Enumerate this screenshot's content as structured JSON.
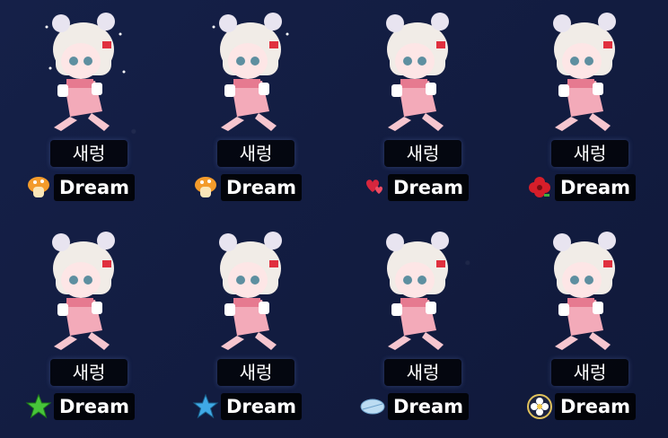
{
  "cards": [
    {
      "name": "새렁",
      "guild": "Dream",
      "emblem": "orange-mushroom-icon"
    },
    {
      "name": "새렁",
      "guild": "Dream",
      "emblem": "orange-mushroom-icon"
    },
    {
      "name": "새렁",
      "guild": "Dream",
      "emblem": "hearts-icon"
    },
    {
      "name": "새렁",
      "guild": "Dream",
      "emblem": "red-flower-icon"
    },
    {
      "name": "새렁",
      "guild": "Dream",
      "emblem": "green-star-icon"
    },
    {
      "name": "새렁",
      "guild": "Dream",
      "emblem": "blue-star-icon"
    },
    {
      "name": "새렁",
      "guild": "Dream",
      "emblem": "feather-icon"
    },
    {
      "name": "새렁",
      "guild": "Dream",
      "emblem": "daisy-icon"
    }
  ],
  "colors": {
    "background": "#141d42",
    "hair": "#f1ece7",
    "dress": "#f3aab9",
    "bow": "#e0303e"
  }
}
